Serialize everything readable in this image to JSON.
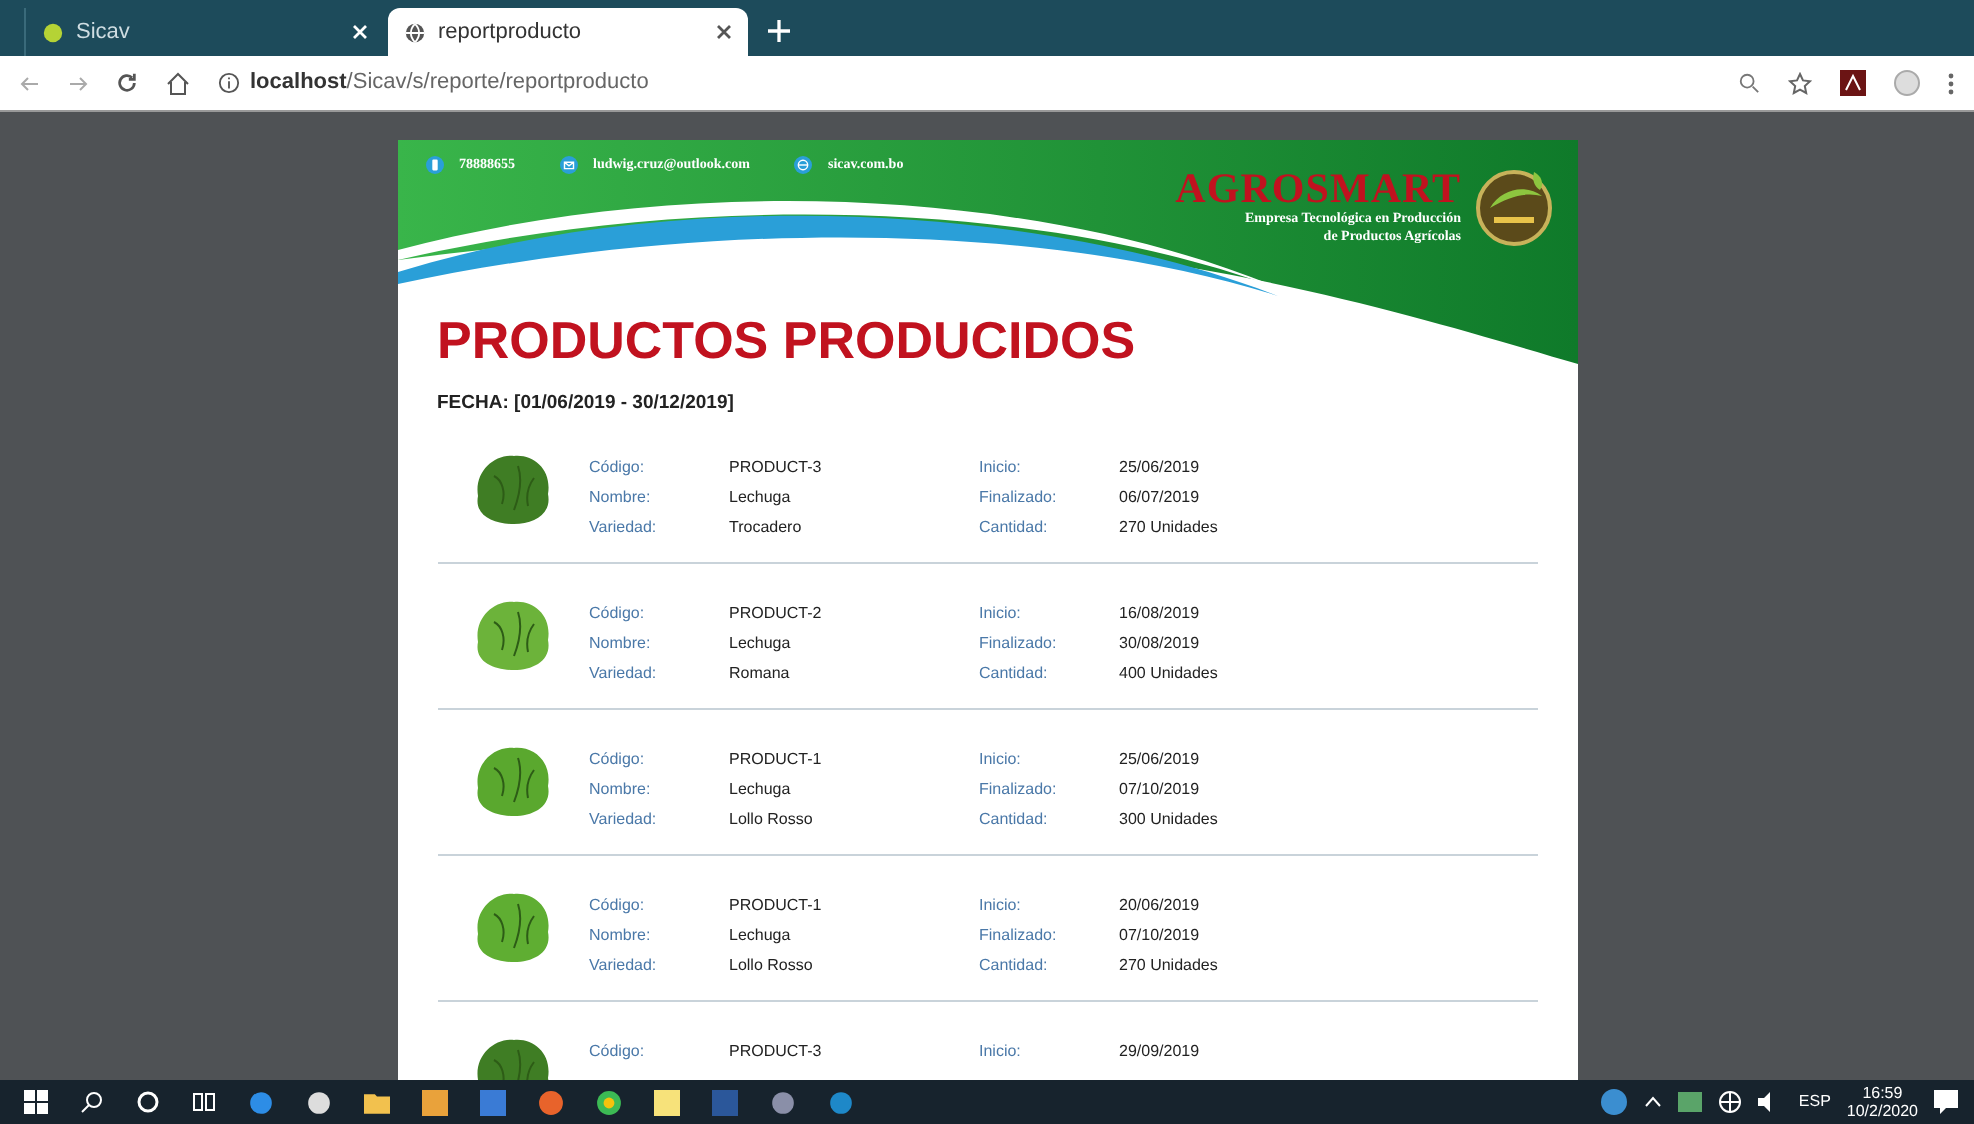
{
  "browser": {
    "tabs": [
      {
        "title": "Sicav",
        "selected": false
      },
      {
        "title": "reportproducto",
        "selected": true
      }
    ],
    "address": {
      "host": "localhost",
      "path": "/Sicav/s/reporte/reportproducto"
    }
  },
  "report": {
    "contacts": [
      {
        "kind": "phone",
        "text": "78888655"
      },
      {
        "kind": "mail",
        "text": "ludwig.cruz@outlook.com"
      },
      {
        "kind": "web",
        "text": "sicav.com.bo"
      }
    ],
    "brand": "AGROSMART",
    "tagline": [
      "Empresa Tecnológica en Producción",
      "de Productos Agrícolas"
    ],
    "title": "PRODUCTOS PRODUCIDOS",
    "date_range": "FECHA: [01/06/2019 - 30/12/2019]",
    "products": [
      {
        "left": [
          [
            "Código:",
            "PRODUCT-3"
          ],
          [
            "Nombre:",
            "Lechuga"
          ],
          [
            "Variedad:",
            "Trocadero"
          ]
        ],
        "right": [
          [
            "Inicio:",
            "25/06/2019"
          ],
          [
            "Finalizado:",
            "06/07/2019"
          ],
          [
            "Cantidad:",
            "270 Unidades"
          ]
        ]
      },
      {
        "left": [
          [
            "Código:",
            "PRODUCT-2"
          ],
          [
            "Nombre:",
            "Lechuga"
          ],
          [
            "Variedad:",
            "Romana"
          ]
        ],
        "right": [
          [
            "Inicio:",
            "16/08/2019"
          ],
          [
            "Finalizado:",
            "30/08/2019"
          ],
          [
            "Cantidad:",
            "400 Unidades"
          ]
        ]
      },
      {
        "left": [
          [
            "Código:",
            "PRODUCT-1"
          ],
          [
            "Nombre:",
            "Lechuga"
          ],
          [
            "Variedad:",
            "Lollo Rosso"
          ]
        ],
        "right": [
          [
            "Inicio:",
            "25/06/2019"
          ],
          [
            "Finalizado:",
            "07/10/2019"
          ],
          [
            "Cantidad:",
            "300 Unidades"
          ]
        ]
      },
      {
        "left": [
          [
            "Código:",
            "PRODUCT-1"
          ],
          [
            "Nombre:",
            "Lechuga"
          ],
          [
            "Variedad:",
            "Lollo Rosso"
          ]
        ],
        "right": [
          [
            "Inicio:",
            "20/06/2019"
          ],
          [
            "Finalizado:",
            "07/10/2019"
          ],
          [
            "Cantidad:",
            "270 Unidades"
          ]
        ]
      },
      {
        "left": [
          [
            "Código:",
            "PRODUCT-3"
          ]
        ],
        "right": [
          [
            "Inicio:",
            "29/09/2019"
          ]
        ]
      }
    ]
  },
  "taskbar": {
    "language": "ESP",
    "time": "16:59",
    "date": "10/2/2020"
  }
}
